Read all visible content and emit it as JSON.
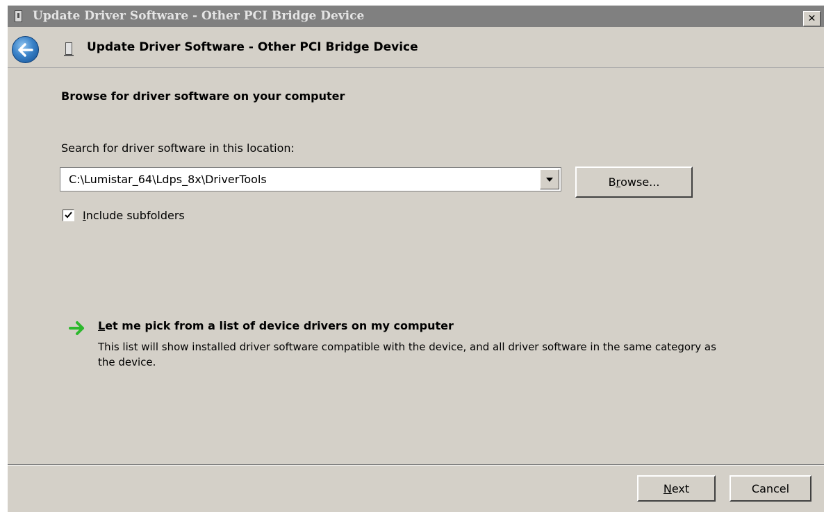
{
  "window": {
    "title": "Update Driver Software - Other PCI Bridge Device",
    "close_glyph": "✕"
  },
  "nav": {
    "title": "Update Driver Software - Other PCI Bridge Device",
    "back_icon": "back-arrow-icon",
    "device_icon": "device-icon"
  },
  "page": {
    "heading": "Browse for driver software on your computer",
    "search_label": "Search for driver software in this location:",
    "path_value": "C:\\Lumistar_64\\Ldps_8x\\DriverTools",
    "browse_label": {
      "pre": "B",
      "accel": "r",
      "post": "owse..."
    },
    "include_subfolders": {
      "accel": "I",
      "post": "nclude subfolders",
      "checked": true
    },
    "pick": {
      "title_accel": "L",
      "title_post": "et me pick from a list of device drivers on my computer",
      "description": "This list will show installed driver software compatible with the device, and all driver software in the same category as the device."
    }
  },
  "footer": {
    "next": {
      "accel": "N",
      "post": "ext"
    },
    "cancel": "Cancel"
  },
  "colors": {
    "dialog_bg": "#d4d0c8",
    "titlebar_bg": "#808080",
    "back_button_blue": "#3a82c8",
    "pick_arrow_green": "#2db82d"
  }
}
